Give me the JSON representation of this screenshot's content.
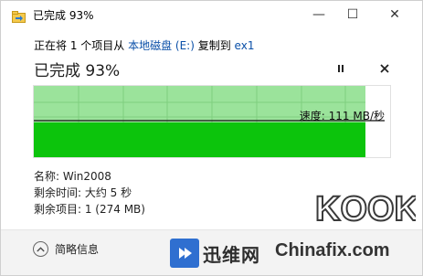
{
  "window": {
    "title": "已完成 93%"
  },
  "window_buttons": {
    "minimize": "—",
    "maximize": "☐",
    "close": "✕"
  },
  "operation": {
    "prefix": "正在将 1 个项目从 ",
    "source": "本地磁盘 (E:)",
    "middle": " 复制到 ",
    "destination": "ex1",
    "status": "已完成 93%",
    "progress_percent": 93
  },
  "graph": {
    "speed_label": "速度: 111 MB/秒"
  },
  "details": {
    "name": "名称: Win2008",
    "time_left": "剩余时间: 大约 5 秒",
    "items_left": "剩余项目: 1 (274 MB)"
  },
  "footer": {
    "toggle_label": "简略信息"
  },
  "watermarks": {
    "xunwei_text": "迅维网",
    "chinafix_text": "Chinafix.com",
    "kook_text": "KOOK"
  },
  "colors": {
    "graph_progress_light": "#9be39b",
    "graph_bar_dark": "#0cc40c",
    "link": "#0b50a8",
    "xunwei_blue": "#2f6fd0"
  }
}
